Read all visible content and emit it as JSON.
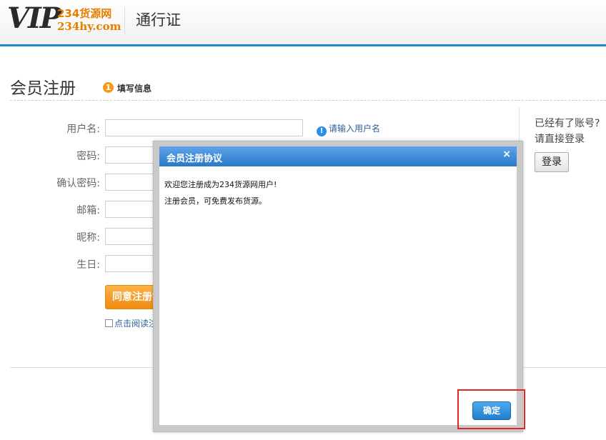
{
  "header": {
    "logo_main": "VIP",
    "logo_cn": "234货源网",
    "logo_domain": "234hy.com",
    "title": "通行证"
  },
  "page": {
    "title": "会员注册",
    "step_number": "1",
    "step_label": "填写信息"
  },
  "form": {
    "fields": [
      {
        "label": "用户名:",
        "value": ""
      },
      {
        "label": "密码:",
        "value": ""
      },
      {
        "label": "确认密码:",
        "value": ""
      },
      {
        "label": "邮箱:",
        "value": ""
      },
      {
        "label": "昵称:",
        "value": ""
      },
      {
        "label": "生日:",
        "value": ""
      }
    ],
    "username_hint": "请输入用户名",
    "hint_icon": "!",
    "agree_button": "同意注册协",
    "agree_check_label": "点击阅读注"
  },
  "sidebar": {
    "line1": "已经有了账号?",
    "line2": "请直接登录",
    "login_button": "登录"
  },
  "modal": {
    "title": "会员注册协议",
    "close": "×",
    "line1": "欢迎您注册成为234货源网用户!",
    "line2": "注册会员，可免费发布货源。",
    "ok_button": "确定"
  },
  "colors": {
    "accent_blue": "#1f86cf",
    "orange": "#f08a10",
    "highlight_red": "#e32525"
  }
}
